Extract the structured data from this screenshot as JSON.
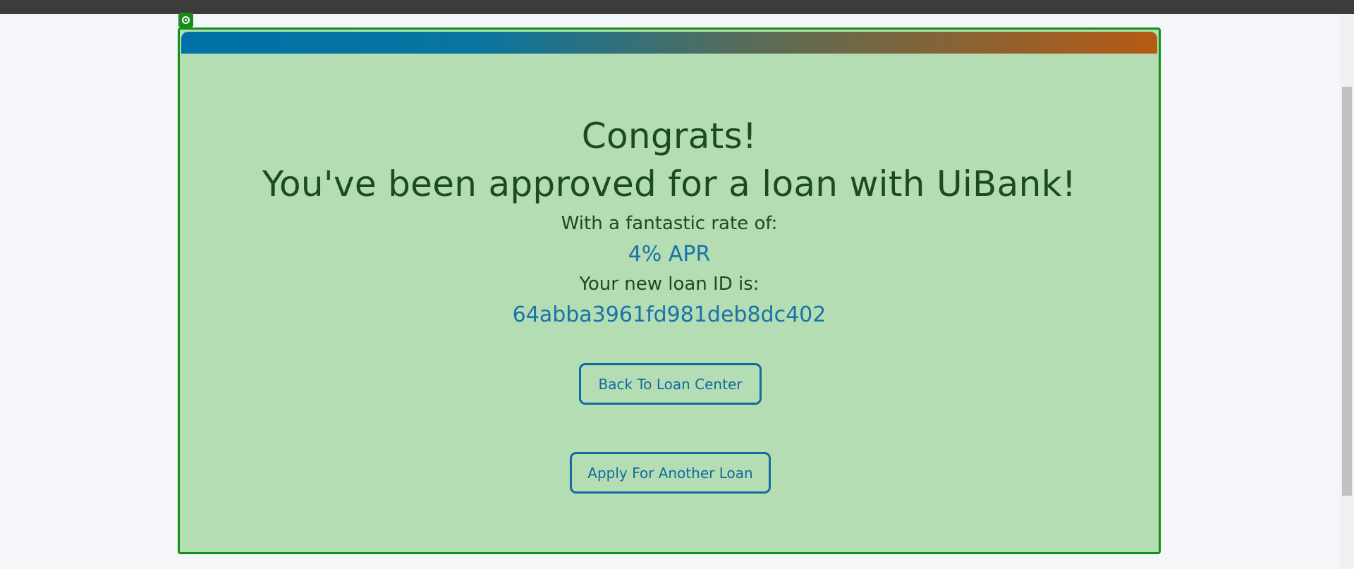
{
  "page": {
    "headline_1": "Congrats!",
    "headline_2": "You've been approved for a loan with UiBank!",
    "rate_label": "With a fantastic rate of:",
    "rate_value": "4% APR",
    "loan_id_label": "Your new loan ID is:",
    "loan_id_value": "64abba3961fd981deb8dc402"
  },
  "buttons": {
    "back_label": "Back To Loan Center",
    "apply_label": "Apply For Another Loan"
  },
  "colors": {
    "card_background": "#b4ddb4",
    "card_border": "#129212",
    "heading_text": "#1d4a1f",
    "accent_blue": "#1972a8",
    "banner_start": "#0071a6",
    "banner_end": "#b55a14"
  },
  "icons": {
    "target_marker": "target-icon"
  }
}
